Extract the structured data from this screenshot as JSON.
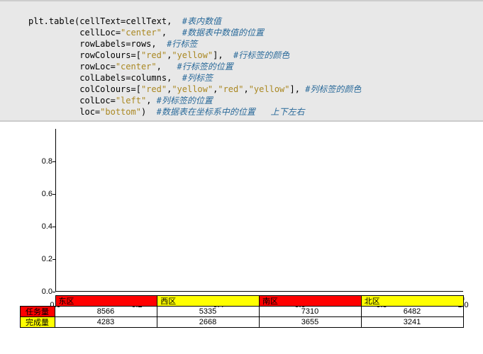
{
  "code": {
    "l1a": "plt.table(cellText=cellText,  ",
    "l1c": "#表内数值",
    "l2a": "          cellLoc=",
    "l2s": "\"center\"",
    "l2b": ",   ",
    "l2c": "#数据表中数值的位置",
    "l3a": "          rowLabels=rows,  ",
    "l3c": "#行标签",
    "l4a": "          rowColours=[",
    "l4s1": "\"red\"",
    "l4m": ",",
    "l4s2": "\"yellow\"",
    "l4b": "],  ",
    "l4c": "#行标签的颜色",
    "l5a": "          rowLoc=",
    "l5s": "\"center\"",
    "l5b": ",   ",
    "l5c": "#行标签的位置",
    "l6a": "          colLabels=columns,  ",
    "l6c": "#列标签",
    "l7a": "          colColours=[",
    "l7s1": "\"red\"",
    "l7m1": ",",
    "l7s2": "\"yellow\"",
    "l7m2": ",",
    "l7s3": "\"red\"",
    "l7m3": ",",
    "l7s4": "\"yellow\"",
    "l7b": "], ",
    "l7c": "#列标签的颜色",
    "l8a": "          colLoc=",
    "l8s": "\"left\"",
    "l8b": ", ",
    "l8c": "#列标签的位置",
    "l9a": "          loc=",
    "l9s": "\"bottom\"",
    "l9b": ")  ",
    "l9c": "#数据表在坐标系中的位置   上下左右"
  },
  "chart_data": {
    "type": "table",
    "title": "",
    "xlabel": "",
    "ylabel": "",
    "xlim": [
      0.0,
      1.0
    ],
    "ylim": [
      0.0,
      1.0
    ],
    "xticks": [
      0.0,
      0.2,
      0.4,
      0.6,
      0.8,
      1.0
    ],
    "yticks": [
      0.0,
      0.2,
      0.4,
      0.6,
      0.8
    ],
    "col_labels": [
      "东区",
      "西区",
      "南区",
      "北区"
    ],
    "col_colours": [
      "red",
      "yellow",
      "red",
      "yellow"
    ],
    "row_labels": [
      "任务量",
      "完成量"
    ],
    "row_colours": [
      "red",
      "yellow"
    ],
    "cells": [
      [
        8566,
        5335,
        7310,
        6482
      ],
      [
        4283,
        2668,
        3655,
        3241
      ]
    ]
  },
  "xtick_labels": {
    "0": "0.0",
    "1": "0.2",
    "2": "0.4",
    "3": "0.6",
    "4": "0.8",
    "5": "1.0"
  },
  "ytick_labels": {
    "0": "0.0",
    "1": "0.2",
    "2": "0.4",
    "3": "0.6",
    "4": "0.8"
  }
}
